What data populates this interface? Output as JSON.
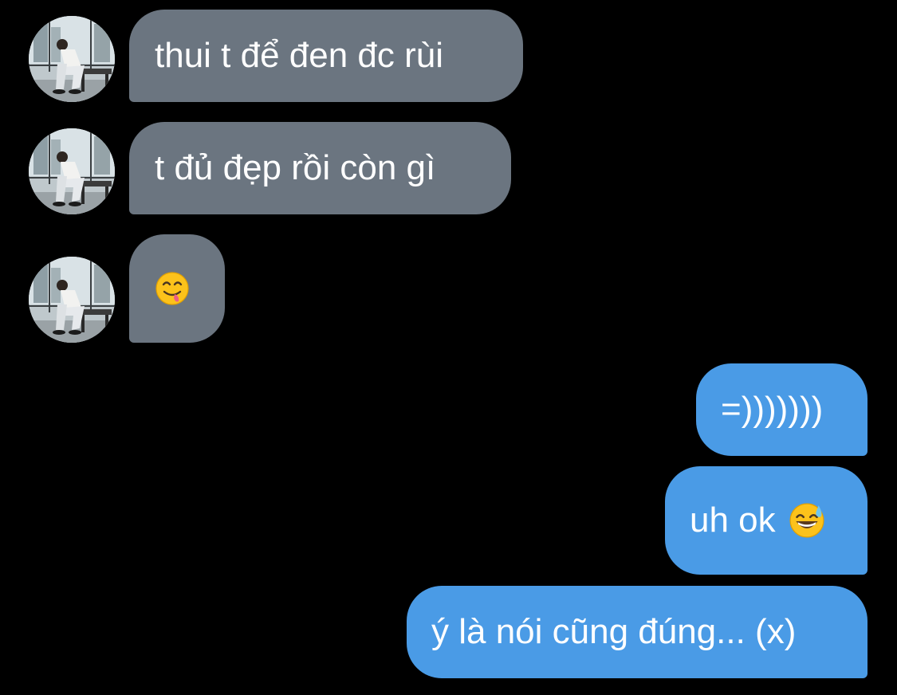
{
  "conversation": {
    "incoming": [
      {
        "text": "thui t để đen đc rùi",
        "sender_avatar": "person-sitting-avatar"
      },
      {
        "text": "t đủ đẹp rồi còn gì",
        "sender_avatar": "person-sitting-avatar"
      },
      {
        "text": "",
        "emoji": "face-savoring-food-emoji",
        "sender_avatar": "person-sitting-avatar"
      }
    ],
    "outgoing": [
      {
        "text": "=)))))))"
      },
      {
        "text": "uh ok",
        "emoji": "grinning-face-with-sweat-emoji"
      },
      {
        "text": "ý là nói cũng đúng... (x)"
      }
    ]
  },
  "colors": {
    "background": "#000000",
    "incoming_bubble": "#6b7580",
    "outgoing_bubble": "#4a9be6",
    "text": "#ffffff"
  }
}
